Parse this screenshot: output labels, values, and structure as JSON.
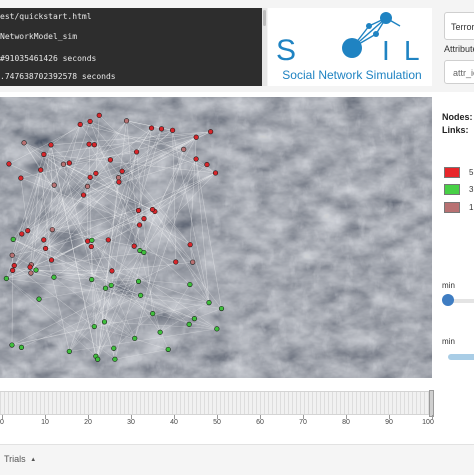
{
  "console": {
    "lines": [
      "est/quickstart.html",
      "NetworkModel_sim",
      "#91035461426 seconds",
      ".747638702392578 seconds"
    ]
  },
  "logo": {
    "letters": [
      "S",
      "I",
      "L"
    ],
    "subtitle": "Social Network Simulation",
    "color": "#1f83c2"
  },
  "controls": {
    "group_select_value": "Terror",
    "attribute_label": "Attribute",
    "attribute_placeholder": "attr_ic"
  },
  "stats": {
    "nodes_label": "Nodes:",
    "links_label": "Links:"
  },
  "legend": [
    {
      "color": "#e8262a",
      "label": "5"
    },
    {
      "color": "#48d046",
      "label": "3"
    },
    {
      "color": "#b87172",
      "label": "1"
    }
  ],
  "sliders": [
    {
      "label": "min",
      "level": 0
    },
    {
      "label": "min",
      "level": 1
    }
  ],
  "timeline": {
    "ticks": [
      "0",
      "10",
      "20",
      "30",
      "40",
      "50",
      "60",
      "70",
      "80",
      "90",
      "100"
    ],
    "value": 100
  },
  "footer": {
    "trials_label": "Trials",
    "caret": "▲"
  }
}
